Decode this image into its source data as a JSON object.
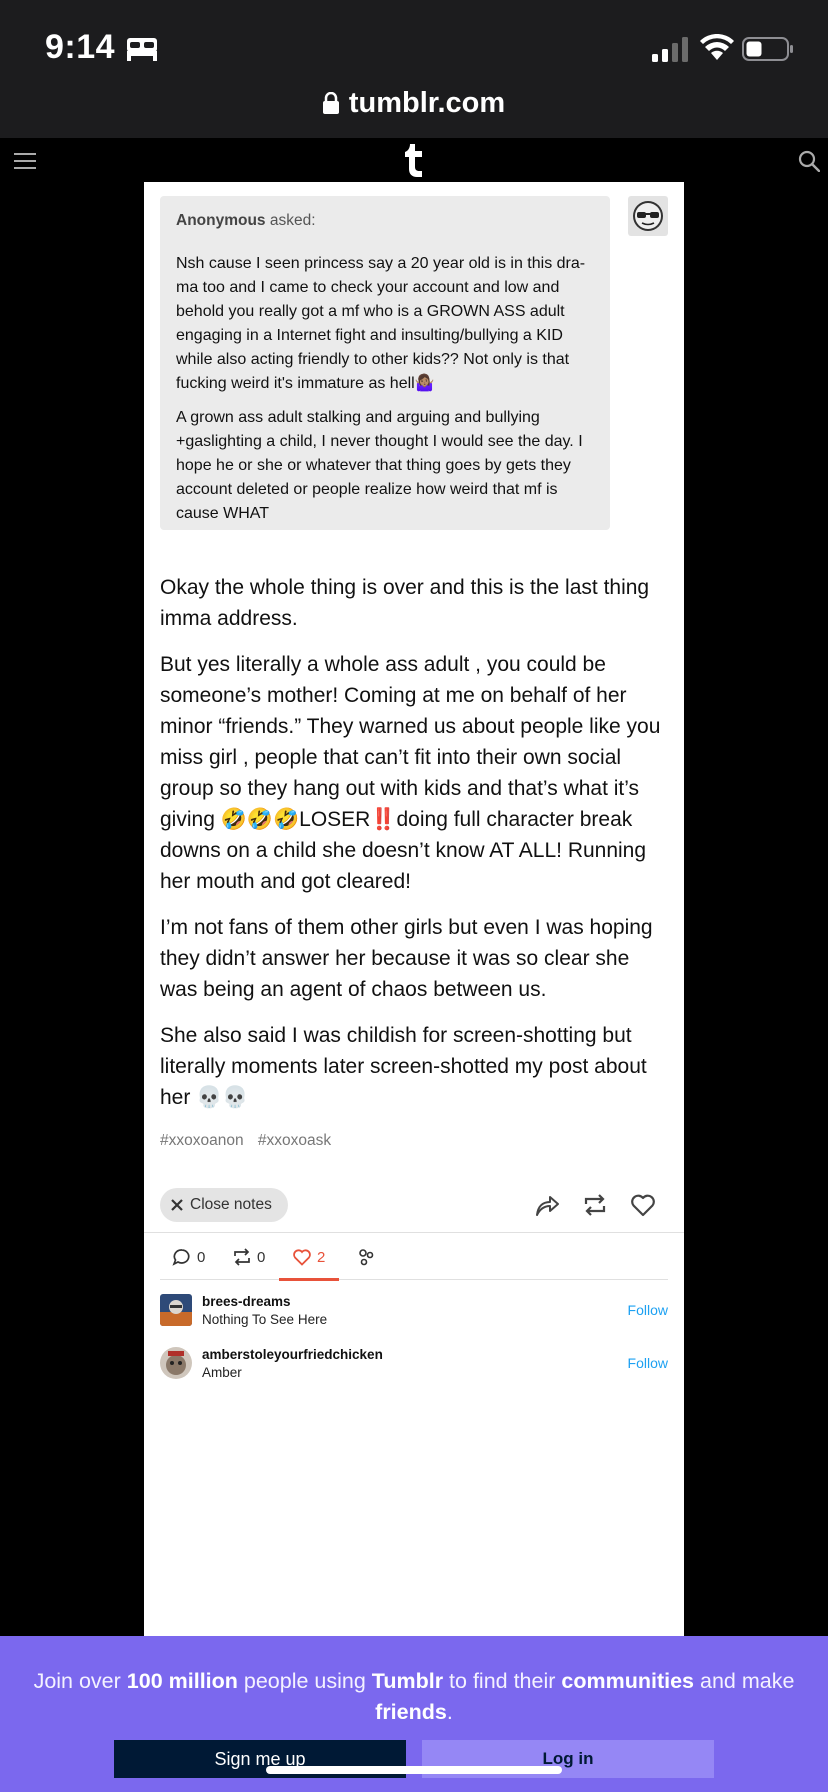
{
  "status_bar": {
    "time": "9:14",
    "icons": [
      "bed-icon",
      "signal-icon",
      "wifi-icon",
      "battery-icon"
    ]
  },
  "browser": {
    "url": "tumblr.com"
  },
  "header": {
    "logo": "t",
    "icons": [
      "menu-icon",
      "search-icon"
    ]
  },
  "ask": {
    "asker": "Anonymous",
    "asked_label": "asked:",
    "paragraphs": [
      "Nsh cause I seen princess say a 20 year old is in this dra-ma too and I came to check your account and low and behold you really got a mf who is a GROWN ASS adult engaging in a Internet fight and insulting/bullying a KID while also acting friendly to other kids?? Not only is that fucking weird it's immature as hell🤷🏽‍♀️",
      "A grown ass adult stalking and arguing and bullying +gaslighting a child, I never thought I would see the day. I hope he or she or whatever that thing goes by gets they account deleted or people realize how weird that mf is cause WHAT"
    ]
  },
  "answer": {
    "paragraphs": [
      "Okay the whole thing is over and this is the last thing imma address.",
      "But yes literally a whole ass adult , you could be someone’s mother! Coming at me on behalf of her minor “friends.” They warned us about people like you miss girl , people that can’t fit into their own social group so they hang out with kids and that’s what it’s giving 🤣🤣🤣LOSER‼️doing full character break downs on a child she doesn’t know AT ALL! Running her mouth and got cleared!",
      "I’m not fans of them other girls but even I was hoping they didn’t answer her because it was so clear she was  being an agent of chaos between us.",
      "She also said I was childish for screen-shotting but literally moments later screen-shotted my post about her 💀💀"
    ]
  },
  "tags": [
    "#xxoxoanon",
    "#xxoxoask"
  ],
  "actions": {
    "close_notes_label": "Close notes"
  },
  "notes_tabs": {
    "replies_count": "0",
    "reblogs_count": "0",
    "likes_count": "2"
  },
  "notes": [
    {
      "username": "brees-dreams",
      "blog_title": "Nothing To See Here",
      "follow_label": "Follow"
    },
    {
      "username": "amberstoleyourfriedchicken",
      "blog_title": "Amber",
      "follow_label": "Follow"
    }
  ],
  "signup": {
    "text_1": "Join over ",
    "highlight_1": "100 million",
    "text_2": " people using ",
    "highlight_2": "Tumblr",
    "text_3": " to find their ",
    "highlight_3": "communities",
    "text_4": " and make ",
    "highlight_4": "friends",
    "text_5": ".",
    "signup_label": "Sign me up",
    "login_label": "Log in"
  },
  "colors": {
    "banner": "#7b68ee",
    "accent_like": "#e8523a",
    "follow": "#1da1f2",
    "navy": "#001935"
  }
}
